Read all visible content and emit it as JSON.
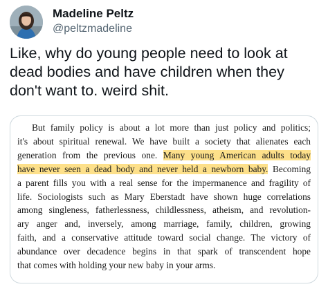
{
  "author": {
    "name": "Madeline Peltz",
    "handle": "@peltzmadeline",
    "avatar_icon": "profile-photo-avatar"
  },
  "tweet": {
    "text": "Like, why do young people need to look at\ndead bodies and have children when they\ndon't want to. weird shit."
  },
  "excerpt": {
    "highlight_color": "#fde08a",
    "lines": [
      {
        "pre": "But family policy is about a lot more than just policy and politics;",
        "hl": "",
        "post": ""
      },
      {
        "pre": "it's about spiritual renewal. We have built a society that alienates each",
        "hl": "",
        "post": ""
      },
      {
        "pre": "generation from the previous one. ",
        "hl": "Many young American adults today",
        "post": ""
      },
      {
        "pre": "",
        "hl": "have never seen a dead body and never held a newborn baby.",
        "post": " Becoming"
      },
      {
        "pre": "a parent fills you with a real sense for the impermanence and fragility of",
        "hl": "",
        "post": ""
      },
      {
        "pre": "life. Sociologists such as Mary Eberstadt have shown huge correlations",
        "hl": "",
        "post": ""
      },
      {
        "pre": "among singleness, fatherlessness, childlessness, atheism, and revolution-",
        "hl": "",
        "post": ""
      },
      {
        "pre": "ary anger and, inversely, among marriage, family, children, growing",
        "hl": "",
        "post": ""
      },
      {
        "pre": "faith, and a conservative attitude toward social change. The victory of",
        "hl": "",
        "post": ""
      },
      {
        "pre": "abundance over decadence begins in that spark of transcendent hope",
        "hl": "",
        "post": ""
      },
      {
        "pre": "that comes with holding your new baby in your arms.",
        "hl": "",
        "post": ""
      }
    ]
  }
}
